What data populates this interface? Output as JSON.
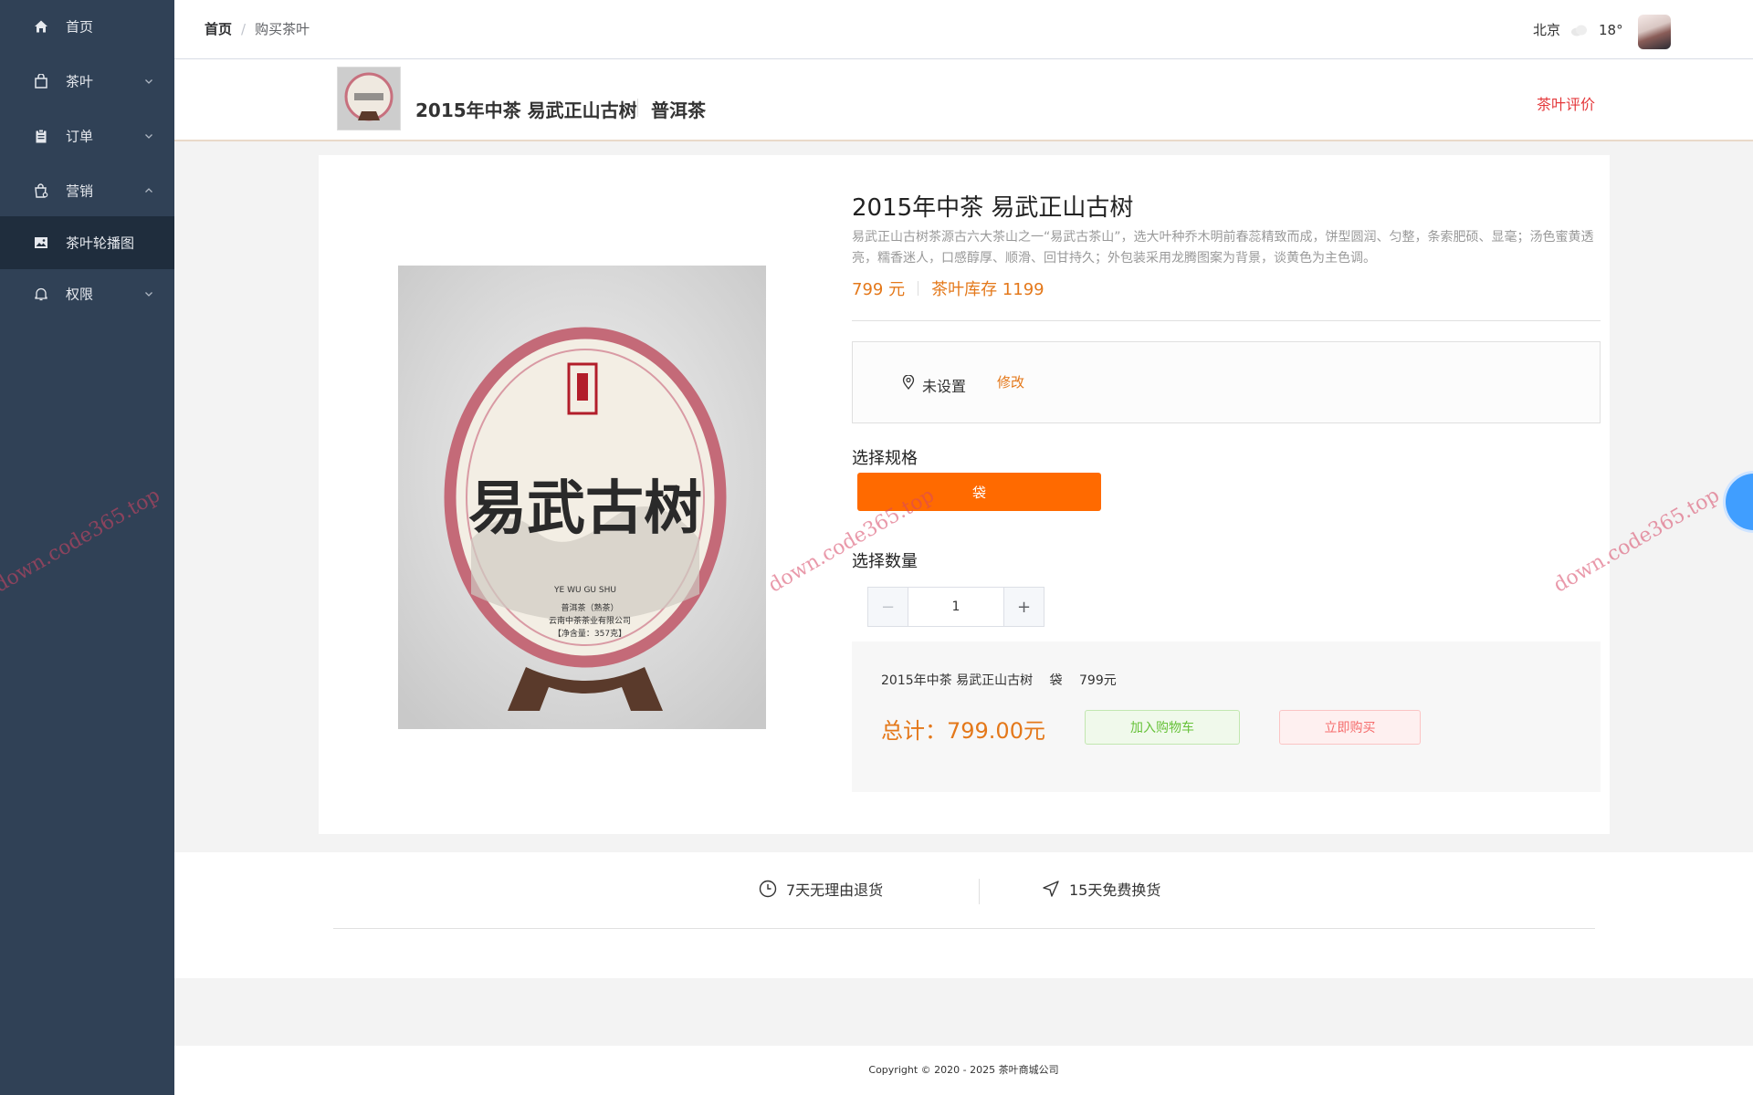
{
  "sidebar": {
    "items": [
      {
        "label": "首页",
        "icon": "home-icon"
      },
      {
        "label": "茶叶",
        "icon": "bag-icon"
      },
      {
        "label": "订单",
        "icon": "clipboard-icon"
      },
      {
        "label": "营销",
        "icon": "shopping-icon"
      },
      {
        "label": "茶叶轮播图",
        "icon": "picture-icon"
      },
      {
        "label": "权限",
        "icon": "bell-icon"
      }
    ]
  },
  "header": {
    "breadcrumb": {
      "home": "首页",
      "separator": "/",
      "current": "购买茶叶"
    },
    "weather": {
      "city": "北京",
      "temp": "18°"
    }
  },
  "product": {
    "name": "2015年中茶 易武正山古树",
    "category": "普洱茶",
    "review_link": "茶叶评价",
    "description": "易武正山古树茶源古六大茶山之一“易武古茶山”，选大叶种乔木明前春蕊精致而成，饼型圆润、匀整，条索肥硕、显毫；汤色蜜黄透亮，糯香迷人，口感醇厚、顺滑、回甘持久；外包装采用龙腾图案为背景，谈黄色为主色调。",
    "price": "799 元",
    "stock": "茶叶库存 1199",
    "image_text": {
      "big": "易武古树",
      "pinyin": "YE WU GU SHU",
      "l1": "普洱茶（熟茶）",
      "l2": "云南中茶茶业有限公司",
      "l3": "【净含量：357克】"
    }
  },
  "address": {
    "text": "未设置",
    "edit": "修改"
  },
  "spec": {
    "label": "选择规格",
    "option": "袋"
  },
  "quantity": {
    "label": "选择数量",
    "minus": "−",
    "plus": "+",
    "value": "1"
  },
  "summary": {
    "name": "2015年中茶 易武正山古树",
    "spec": "袋",
    "price": "799元",
    "total": "总计：799.00元",
    "add_cart": "加入购物车",
    "buy_now": "立即购买"
  },
  "services": {
    "return": "7天无理由退货",
    "exchange": "15天免费换货"
  },
  "footer": {
    "copyright": "Copyright © 2020 - 2025   茶叶商城公司"
  },
  "watermark": "down.code365.top",
  "colors": {
    "sidebar": "#304156",
    "accent": "#ff6a00",
    "price": "#e4781a",
    "link": "#e4393c"
  }
}
